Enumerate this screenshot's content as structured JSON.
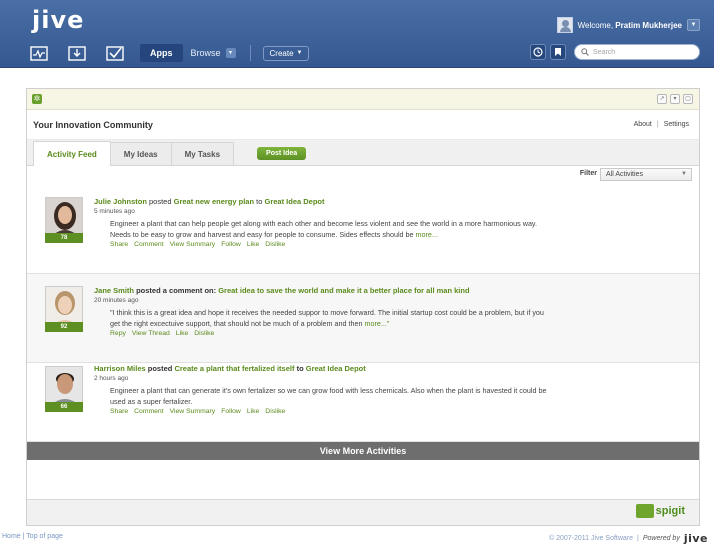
{
  "header": {
    "logo": "jive",
    "welcome_prefix": "Welcome,",
    "user_name": "Pratim Mukherjee",
    "nav": {
      "apps": "Apps",
      "browse": "Browse",
      "create": "Create"
    },
    "search_placeholder": "Search"
  },
  "widget": {
    "title": "Your Innovation Community",
    "links": {
      "about": "About",
      "sep": "|",
      "settings": "Settings"
    },
    "tabs": [
      "Activity Feed",
      "My Ideas",
      "My Tasks"
    ],
    "post_idea": "Post Idea",
    "filter_label": "Filter",
    "filter_value": "All Activities",
    "activities": [
      {
        "user": "Julie Johnston",
        "verb": " posted ",
        "object": "Great new energy plan",
        "prep": " to ",
        "target": "Great Idea Depot",
        "time": "5 minutes ago",
        "score": "78",
        "body": "Engineer a plant that can help people get along with each other and become less violent and see the world in a more harmonious way. Needs to be easy to grow and harvest and easy for people to consume. Sides effects should be",
        "more": "more...",
        "actions": [
          "Share",
          "Comment",
          "View Summary",
          "Follow",
          "Like",
          "Dislike"
        ]
      },
      {
        "user": "Jane Smith",
        "verb": " posted a comment on: ",
        "object": "Great idea to save the world and make it a better place for all man kind",
        "prep": "",
        "target": "",
        "time": "20 minutes ago",
        "score": "92",
        "body": "\"I think this is a great idea and hope it receives the needed suppor to move forward. The initial startup cost could be a problem, but if you get the right excectuive support, that should not be much of a problem and then",
        "more": "more...\"",
        "actions": [
          "Repy",
          "View Thread",
          "Like",
          "Dislike"
        ]
      },
      {
        "user": "Harrison Miles",
        "verb": " posted ",
        "object": "Create a plant that fertalized itself",
        "prep": " to ",
        "target": "Great Idea Depot",
        "time": "2 hours ago",
        "score": "66",
        "body": "Engineer a plant that can generate it's own fertalizer so we can grow food with less chemicals. Also when the plant is havested it could be used as a super fertalizer.",
        "more": "",
        "actions": [
          "Share",
          "Comment",
          "View Summary",
          "Follow",
          "Like",
          "Dislike"
        ]
      }
    ],
    "view_more": "View More Activities",
    "spigit": "spigit"
  },
  "footer": {
    "home": "Home",
    "sep": "|",
    "top": "Top of page",
    "copyright": "© 2007-2011 Jive Software",
    "powered": "Powered by",
    "brand": "jive"
  },
  "colors": {
    "header_blue": "#3e62a0",
    "accent_green": "#5a8a1b"
  }
}
